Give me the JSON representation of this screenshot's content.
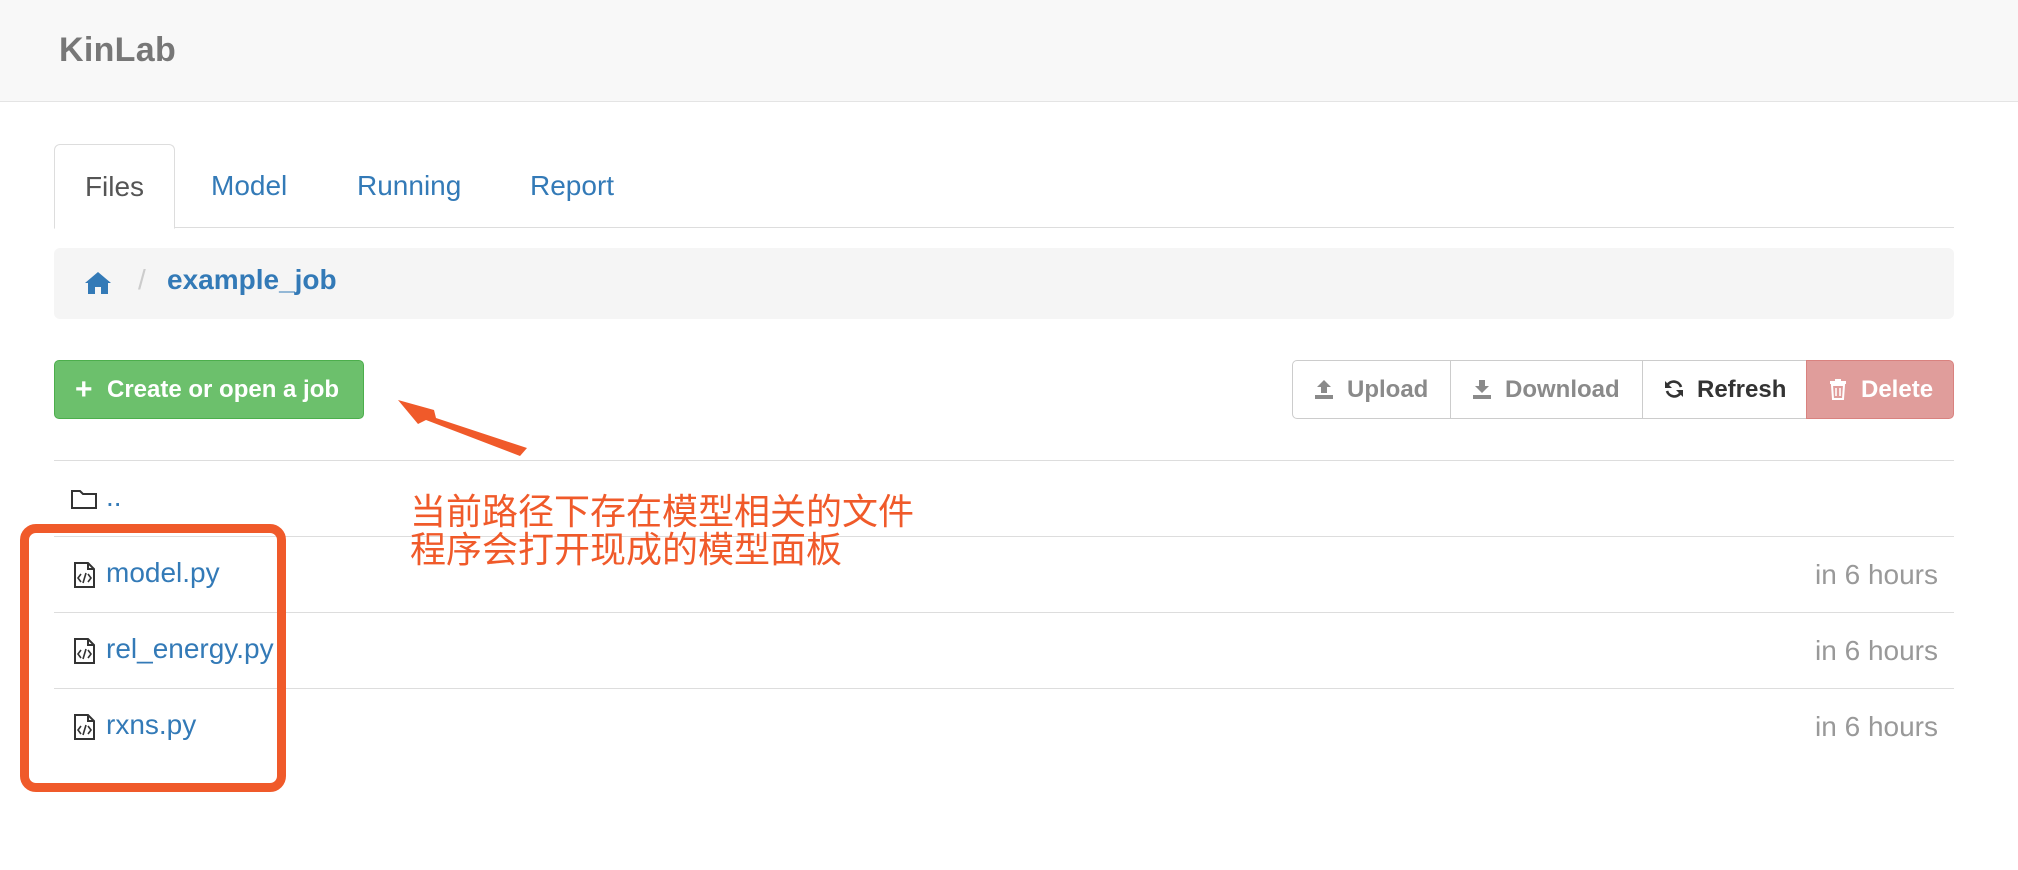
{
  "app": {
    "brand": "KinLab"
  },
  "tabs": [
    {
      "label": "Files",
      "active": true
    },
    {
      "label": "Model",
      "active": false
    },
    {
      "label": "Running",
      "active": false
    },
    {
      "label": "Report",
      "active": false
    }
  ],
  "breadcrumb": {
    "home_icon": "home-icon",
    "separator": "/",
    "current": "example_job"
  },
  "toolbar": {
    "create_icon": "+",
    "create_label": "Create or open a job",
    "upload_label": "Upload",
    "download_label": "Download",
    "refresh_label": "Refresh",
    "delete_label": "Delete"
  },
  "files": {
    "parent": {
      "name": ".."
    },
    "items": [
      {
        "name": "model.py",
        "modified": "in 6 hours"
      },
      {
        "name": "rel_energy.py",
        "modified": "in 6 hours"
      },
      {
        "name": "rxns.py",
        "modified": "in 6 hours"
      }
    ]
  },
  "annotation": {
    "line1": "当前路径下存在模型相关的文件",
    "line2": "程序会打开现成的模型面板"
  },
  "colors": {
    "link": "#337ab7",
    "success": "#6cc06c",
    "danger_disabled": "#e09d9b",
    "annotation": "#f05a2a"
  }
}
